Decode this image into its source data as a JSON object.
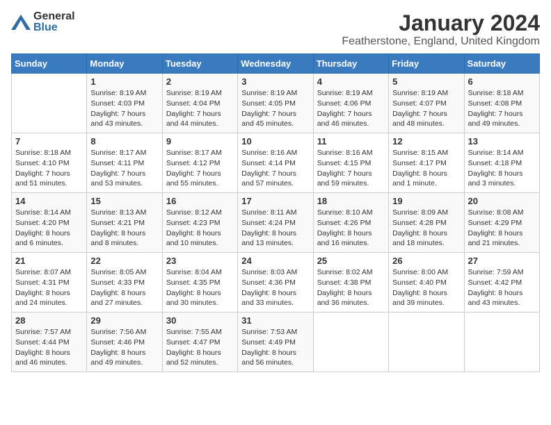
{
  "logo": {
    "general": "General",
    "blue": "Blue"
  },
  "title": "January 2024",
  "subtitle": "Featherstone, England, United Kingdom",
  "days_of_week": [
    "Sunday",
    "Monday",
    "Tuesday",
    "Wednesday",
    "Thursday",
    "Friday",
    "Saturday"
  ],
  "weeks": [
    [
      {
        "day": "",
        "sunrise": "",
        "sunset": "",
        "daylight": ""
      },
      {
        "day": "1",
        "sunrise": "Sunrise: 8:19 AM",
        "sunset": "Sunset: 4:03 PM",
        "daylight": "Daylight: 7 hours and 43 minutes."
      },
      {
        "day": "2",
        "sunrise": "Sunrise: 8:19 AM",
        "sunset": "Sunset: 4:04 PM",
        "daylight": "Daylight: 7 hours and 44 minutes."
      },
      {
        "day": "3",
        "sunrise": "Sunrise: 8:19 AM",
        "sunset": "Sunset: 4:05 PM",
        "daylight": "Daylight: 7 hours and 45 minutes."
      },
      {
        "day": "4",
        "sunrise": "Sunrise: 8:19 AM",
        "sunset": "Sunset: 4:06 PM",
        "daylight": "Daylight: 7 hours and 46 minutes."
      },
      {
        "day": "5",
        "sunrise": "Sunrise: 8:19 AM",
        "sunset": "Sunset: 4:07 PM",
        "daylight": "Daylight: 7 hours and 48 minutes."
      },
      {
        "day": "6",
        "sunrise": "Sunrise: 8:18 AM",
        "sunset": "Sunset: 4:08 PM",
        "daylight": "Daylight: 7 hours and 49 minutes."
      }
    ],
    [
      {
        "day": "7",
        "sunrise": "Sunrise: 8:18 AM",
        "sunset": "Sunset: 4:10 PM",
        "daylight": "Daylight: 7 hours and 51 minutes."
      },
      {
        "day": "8",
        "sunrise": "Sunrise: 8:17 AM",
        "sunset": "Sunset: 4:11 PM",
        "daylight": "Daylight: 7 hours and 53 minutes."
      },
      {
        "day": "9",
        "sunrise": "Sunrise: 8:17 AM",
        "sunset": "Sunset: 4:12 PM",
        "daylight": "Daylight: 7 hours and 55 minutes."
      },
      {
        "day": "10",
        "sunrise": "Sunrise: 8:16 AM",
        "sunset": "Sunset: 4:14 PM",
        "daylight": "Daylight: 7 hours and 57 minutes."
      },
      {
        "day": "11",
        "sunrise": "Sunrise: 8:16 AM",
        "sunset": "Sunset: 4:15 PM",
        "daylight": "Daylight: 7 hours and 59 minutes."
      },
      {
        "day": "12",
        "sunrise": "Sunrise: 8:15 AM",
        "sunset": "Sunset: 4:17 PM",
        "daylight": "Daylight: 8 hours and 1 minute."
      },
      {
        "day": "13",
        "sunrise": "Sunrise: 8:14 AM",
        "sunset": "Sunset: 4:18 PM",
        "daylight": "Daylight: 8 hours and 3 minutes."
      }
    ],
    [
      {
        "day": "14",
        "sunrise": "Sunrise: 8:14 AM",
        "sunset": "Sunset: 4:20 PM",
        "daylight": "Daylight: 8 hours and 6 minutes."
      },
      {
        "day": "15",
        "sunrise": "Sunrise: 8:13 AM",
        "sunset": "Sunset: 4:21 PM",
        "daylight": "Daylight: 8 hours and 8 minutes."
      },
      {
        "day": "16",
        "sunrise": "Sunrise: 8:12 AM",
        "sunset": "Sunset: 4:23 PM",
        "daylight": "Daylight: 8 hours and 10 minutes."
      },
      {
        "day": "17",
        "sunrise": "Sunrise: 8:11 AM",
        "sunset": "Sunset: 4:24 PM",
        "daylight": "Daylight: 8 hours and 13 minutes."
      },
      {
        "day": "18",
        "sunrise": "Sunrise: 8:10 AM",
        "sunset": "Sunset: 4:26 PM",
        "daylight": "Daylight: 8 hours and 16 minutes."
      },
      {
        "day": "19",
        "sunrise": "Sunrise: 8:09 AM",
        "sunset": "Sunset: 4:28 PM",
        "daylight": "Daylight: 8 hours and 18 minutes."
      },
      {
        "day": "20",
        "sunrise": "Sunrise: 8:08 AM",
        "sunset": "Sunset: 4:29 PM",
        "daylight": "Daylight: 8 hours and 21 minutes."
      }
    ],
    [
      {
        "day": "21",
        "sunrise": "Sunrise: 8:07 AM",
        "sunset": "Sunset: 4:31 PM",
        "daylight": "Daylight: 8 hours and 24 minutes."
      },
      {
        "day": "22",
        "sunrise": "Sunrise: 8:05 AM",
        "sunset": "Sunset: 4:33 PM",
        "daylight": "Daylight: 8 hours and 27 minutes."
      },
      {
        "day": "23",
        "sunrise": "Sunrise: 8:04 AM",
        "sunset": "Sunset: 4:35 PM",
        "daylight": "Daylight: 8 hours and 30 minutes."
      },
      {
        "day": "24",
        "sunrise": "Sunrise: 8:03 AM",
        "sunset": "Sunset: 4:36 PM",
        "daylight": "Daylight: 8 hours and 33 minutes."
      },
      {
        "day": "25",
        "sunrise": "Sunrise: 8:02 AM",
        "sunset": "Sunset: 4:38 PM",
        "daylight": "Daylight: 8 hours and 36 minutes."
      },
      {
        "day": "26",
        "sunrise": "Sunrise: 8:00 AM",
        "sunset": "Sunset: 4:40 PM",
        "daylight": "Daylight: 8 hours and 39 minutes."
      },
      {
        "day": "27",
        "sunrise": "Sunrise: 7:59 AM",
        "sunset": "Sunset: 4:42 PM",
        "daylight": "Daylight: 8 hours and 43 minutes."
      }
    ],
    [
      {
        "day": "28",
        "sunrise": "Sunrise: 7:57 AM",
        "sunset": "Sunset: 4:44 PM",
        "daylight": "Daylight: 8 hours and 46 minutes."
      },
      {
        "day": "29",
        "sunrise": "Sunrise: 7:56 AM",
        "sunset": "Sunset: 4:46 PM",
        "daylight": "Daylight: 8 hours and 49 minutes."
      },
      {
        "day": "30",
        "sunrise": "Sunrise: 7:55 AM",
        "sunset": "Sunset: 4:47 PM",
        "daylight": "Daylight: 8 hours and 52 minutes."
      },
      {
        "day": "31",
        "sunrise": "Sunrise: 7:53 AM",
        "sunset": "Sunset: 4:49 PM",
        "daylight": "Daylight: 8 hours and 56 minutes."
      },
      {
        "day": "",
        "sunrise": "",
        "sunset": "",
        "daylight": ""
      },
      {
        "day": "",
        "sunrise": "",
        "sunset": "",
        "daylight": ""
      },
      {
        "day": "",
        "sunrise": "",
        "sunset": "",
        "daylight": ""
      }
    ]
  ]
}
